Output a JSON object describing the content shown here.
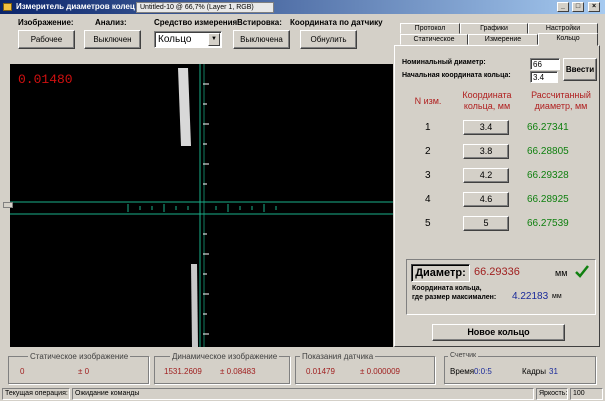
{
  "window": {
    "title": "Измеритель диаметров колец и длин ко...",
    "tooltip": "Untitled-10 @ 66,7% (Layer 1, RGB)"
  },
  "toolbar": {
    "image_label": "Изображение:",
    "image_button": "Рабочее",
    "analysis_label": "Анализ:",
    "analysis_button": "Выключен",
    "measure_label": "Средство измерения:",
    "measure_value": "Кольцо",
    "insert_label": "Встировка:",
    "insert_button": "Выключена",
    "coord_label": "Координата по датчику",
    "coord_button": "Обнулить"
  },
  "video": {
    "reading": "0.01480"
  },
  "tabs": {
    "row1": [
      "Протокол",
      "Графики",
      "Настройки"
    ],
    "row2": [
      "Статическое",
      "Измерение",
      "Кольцо"
    ]
  },
  "ring_panel": {
    "nominal_label": "Номинальный диаметр:",
    "nominal_value": "66",
    "start_label": "Начальная координата кольца:",
    "start_value": "3.4",
    "enter_button": "Ввести",
    "col_n": "N изм.",
    "col_coord": "Координата кольца, мм",
    "col_diam": "Рассчитанный диаметр, мм",
    "rows": [
      {
        "n": "1",
        "coord": "3.4",
        "diam": "66.27341"
      },
      {
        "n": "2",
        "coord": "3.8",
        "diam": "66.28805"
      },
      {
        "n": "3",
        "coord": "4.2",
        "diam": "66.29328"
      },
      {
        "n": "4",
        "coord": "4.6",
        "diam": "66.28925"
      },
      {
        "n": "5",
        "coord": "5",
        "diam": "66.27539"
      }
    ],
    "diameter_label": "Диаметр:",
    "diameter_value": "66.29336",
    "diameter_unit": "мм",
    "max_label_1": "Координата кольца,",
    "max_label_2": "где размер максимален:",
    "max_value": "4.22183",
    "max_unit": "мм",
    "new_ring_button": "Новое кольцо"
  },
  "bottom": {
    "static_title": "Статическое изображение",
    "static_val": "0",
    "static_err": "± 0",
    "dynamic_title": "Динамическое изображение",
    "dynamic_val": "1531.2609",
    "dynamic_err": "± 0.08483",
    "sensor_title": "Показания датчика",
    "sensor_val": "0.01479",
    "sensor_err": "± 0.000009",
    "counter_title": "Счетчик",
    "time_label": "Время",
    "time_val": "0:0:5",
    "frames_label": "Кадры",
    "frames_val": "31"
  },
  "status": {
    "op_label": "Текущая операция:",
    "op_value": "Ожидание команды",
    "brightness_label": "Яркость:",
    "brightness_value": "100"
  },
  "colors": {
    "accent_red": "#a02020",
    "value_green": "#108010",
    "crosshair": "#1ab08a"
  }
}
